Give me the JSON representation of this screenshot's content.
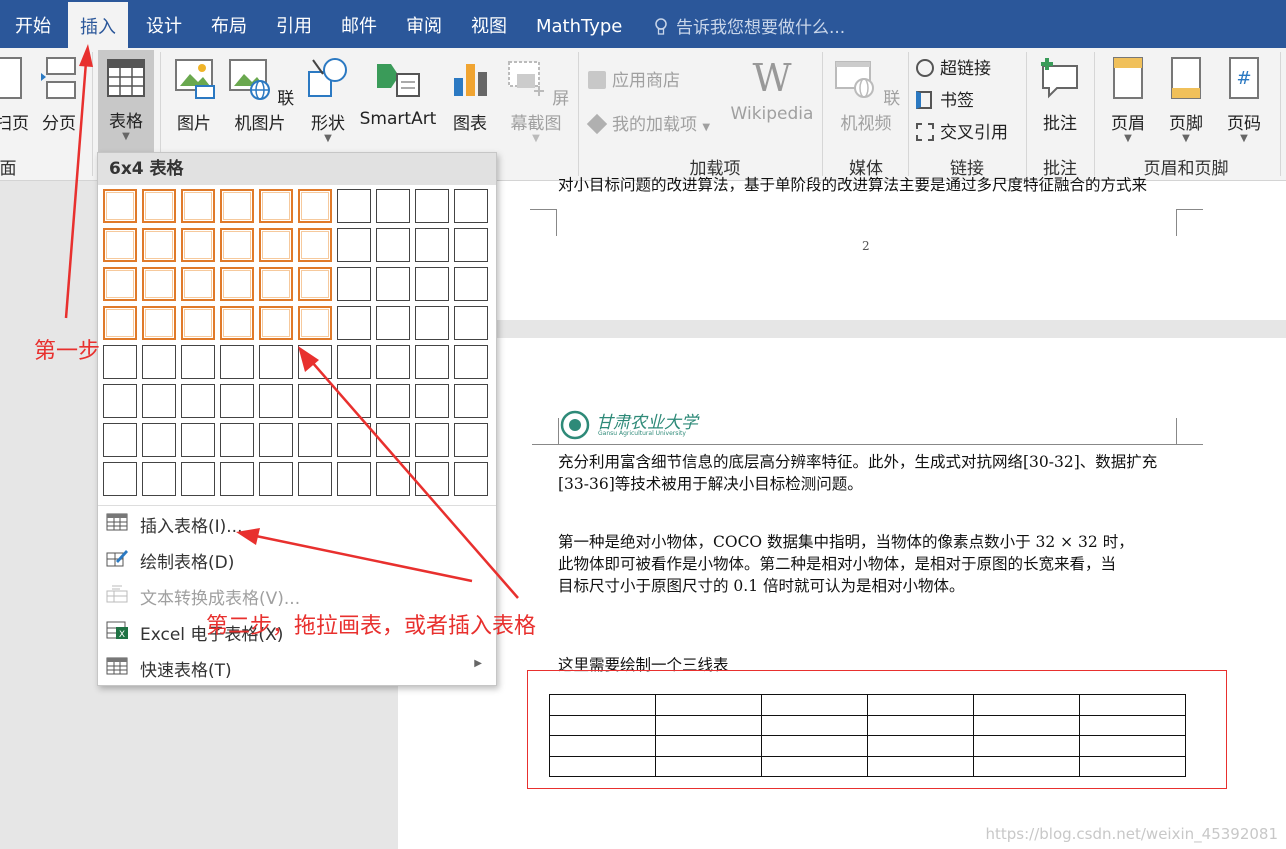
{
  "menu": {
    "tabs": [
      {
        "label": "开始"
      },
      {
        "label": "插入"
      },
      {
        "label": "设计"
      },
      {
        "label": "布局"
      },
      {
        "label": "引用"
      },
      {
        "label": "邮件"
      },
      {
        "label": "审阅"
      },
      {
        "label": "视图"
      },
      {
        "label": "MathType"
      }
    ],
    "active_tab": "插入",
    "tell_me": "告诉我您想要做什么..."
  },
  "ribbon": {
    "pages_group": {
      "cover_partial": "扫页",
      "break": "分页",
      "label_partial": "面"
    },
    "table_btn": "表格",
    "picture_btn": "图片",
    "online_picture_btn": "联机图片",
    "shapes_btn": "形状",
    "smartart_btn": "SmartArt",
    "chart_btn": "图表",
    "screenshot_btn": "屏幕截图",
    "store_btn": "应用商店",
    "my_addins_btn": "我的加载项",
    "wikipedia_btn": "Wikipedia",
    "addins_group": "加载项",
    "online_video_btn": "联机视频",
    "media_group": "媒体",
    "hyperlink_btn": "超链接",
    "bookmark_btn": "书签",
    "crossref_btn": "交叉引用",
    "links_group": "链接",
    "comment_btn": "批注",
    "comment_group": "批注",
    "header_btn": "页眉",
    "footer_btn": "页脚",
    "pagenum_btn": "页码",
    "header_footer_group": "页眉和页脚"
  },
  "table_dropdown": {
    "title": "6x4 表格",
    "grid_cols": 10,
    "grid_rows": 8,
    "selected_cols": 6,
    "selected_rows": 4,
    "items": [
      {
        "label": "插入表格(I)...",
        "enabled": true
      },
      {
        "label": "绘制表格(D)",
        "enabled": true
      },
      {
        "label": "文本转换成表格(V)...",
        "enabled": false
      },
      {
        "label": "Excel 电子表格(X)",
        "enabled": true
      },
      {
        "label": "快速表格(T)",
        "enabled": true
      }
    ]
  },
  "document": {
    "page1_text": "对小目标问题的改进算法，基于单阶段的改进算法主要是通过多尺度特征融合的方式来",
    "page_number": "2",
    "logo_text": "甘肃农业大学",
    "logo_sub": "Gansu Agricultural University",
    "para1_line1": "充分利用富含细节信息的底层高分辨率特征。此外，生成式对抗网络[30-32]、数据扩充",
    "para1_line2": "[33-36]等技术被用于解决小目标检测问题。",
    "para2_line1": "第一种是绝对小物体，COCO  数据集中指明，当物体的像素点数小于  32  ×  32  时，",
    "para2_line2": "此物体即可被看作是小物体。第二种是相对小物体，是相对于原图的长宽来看，当",
    "para2_line3": "目标尺寸小于原图尺寸的  0.1  倍时就可认为是相对小物体。",
    "note": "这里需要绘制一个三线表",
    "table_cols": 6,
    "table_rows": 4
  },
  "annotations": {
    "step1": "第一步",
    "step2": "第二步，拖拉画表，或者插入表格",
    "color": "#e8302e"
  },
  "watermark": "https://blog.csdn.net/weixin_45392081"
}
